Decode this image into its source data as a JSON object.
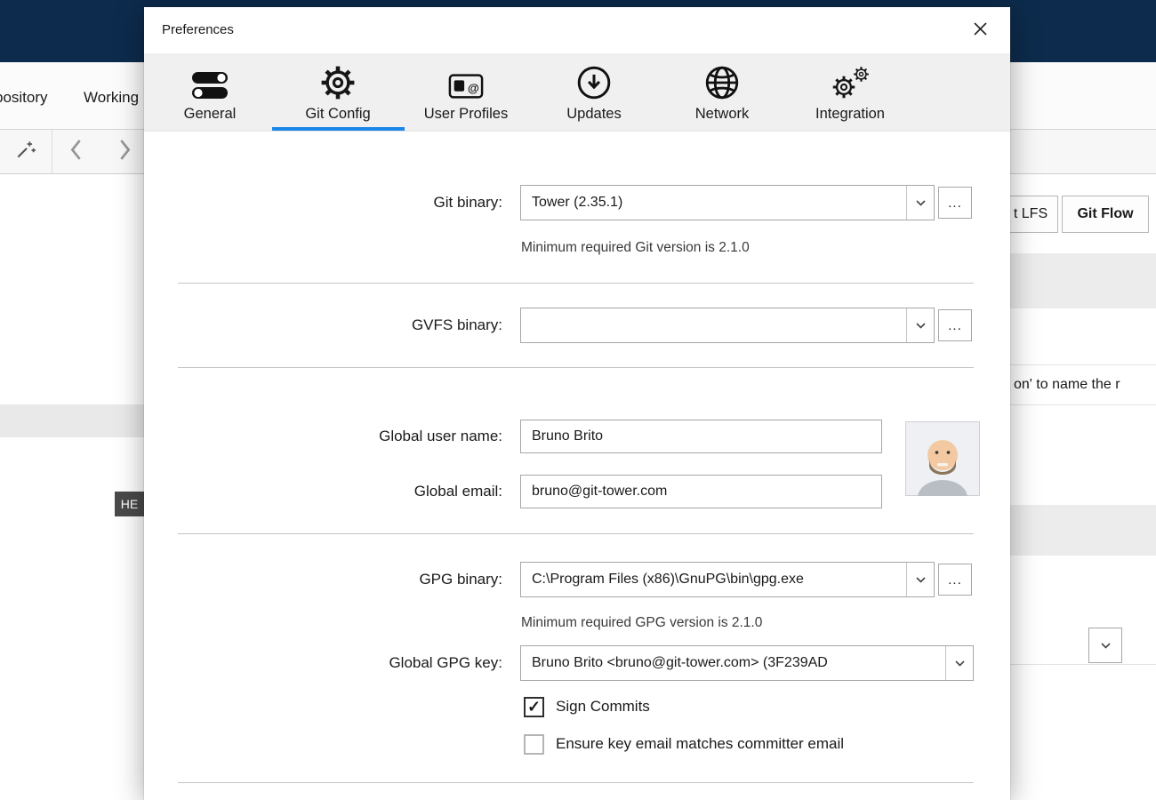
{
  "colors": {
    "titlebar_navy": "#0d2b4c",
    "accent_blue": "#1a86e8",
    "tabbar_gray": "#f0f0f0"
  },
  "background": {
    "menu": [
      "pository",
      "Working"
    ],
    "toolbar_buttons": [
      "t LFS",
      "Git Flow"
    ],
    "partial_text": "on' to name the r",
    "head_badge": "HE"
  },
  "dialog": {
    "title": "Preferences",
    "tabs": [
      {
        "label": "General",
        "icon": "toggles-icon",
        "selected": false
      },
      {
        "label": "Git Config",
        "icon": "gear-icon",
        "selected": true
      },
      {
        "label": "User Profiles",
        "icon": "id-badge-icon",
        "selected": false
      },
      {
        "label": "Updates",
        "icon": "download-circle-icon",
        "selected": false
      },
      {
        "label": "Network",
        "icon": "globe-icon",
        "selected": false
      },
      {
        "label": "Integration",
        "icon": "double-gear-icon",
        "selected": false
      }
    ],
    "form": {
      "git_binary": {
        "label": "Git binary:",
        "value": "Tower (2.35.1)",
        "help": "Minimum required Git version is 2.1.0",
        "browse": "..."
      },
      "gvfs_binary": {
        "label": "GVFS binary:",
        "value": "",
        "browse": "..."
      },
      "global_user_name": {
        "label": "Global user name:",
        "value": "Bruno Brito"
      },
      "global_email": {
        "label": "Global email:",
        "value": "bruno@git-tower.com"
      },
      "gpg_binary": {
        "label": "GPG binary:",
        "value": "C:\\Program Files (x86)\\GnuPG\\bin\\gpg.exe",
        "help": "Minimum required GPG version is 2.1.0",
        "browse": "..."
      },
      "global_gpg_key": {
        "label": "Global GPG key:",
        "value": "Bruno Brito <bruno@git-tower.com> (3F239AD"
      },
      "sign_commits": {
        "label": "Sign Commits",
        "checked": true,
        "glyph": "✓"
      },
      "ensure_key_email": {
        "label": "Ensure key email matches committer email",
        "checked": false,
        "glyph": ""
      }
    }
  }
}
